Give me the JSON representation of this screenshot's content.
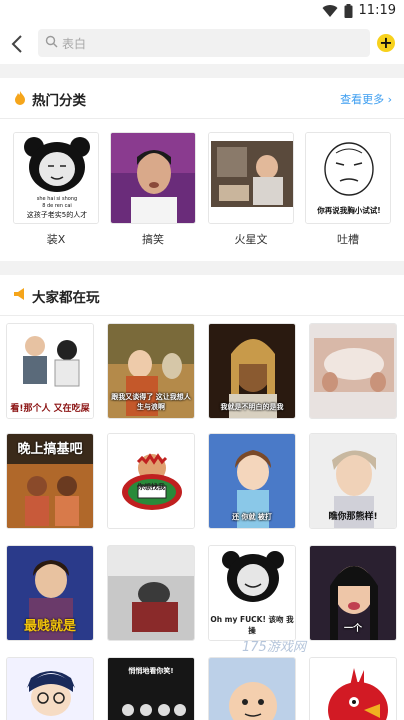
{
  "status": {
    "time": "11:19"
  },
  "header": {
    "search_placeholder": "表白",
    "add_label": "+"
  },
  "hot": {
    "title": "热门分类",
    "more": "查看更多",
    "items": [
      {
        "label": "装X",
        "caption_top": "she hai si shong",
        "caption_mid": "8 de ren cai",
        "caption_bottom": "这孩子老实5的人才"
      },
      {
        "label": "搞笑"
      },
      {
        "label": "火星文"
      },
      {
        "label": "吐槽",
        "caption_bottom": "你再说我胸小试试!"
      }
    ]
  },
  "play": {
    "title": "大家都在玩",
    "cells": [
      {
        "caption": "看!那个人 又在吃屎"
      },
      {
        "caption": "跟我又谈得了 这让我想人生与浪啊"
      },
      {
        "caption": "我就是不明白的是我"
      },
      {
        "caption": ""
      },
      {
        "caption": "晚上搞基吧"
      },
      {
        "caption": "你想找我"
      },
      {
        "caption": "还 你就 被打"
      },
      {
        "caption": "瞧你那熊样!"
      },
      {
        "caption": "最贱就是"
      },
      {
        "caption": ""
      },
      {
        "caption": "Oh my FUCK! 该吻 我操"
      },
      {
        "caption": "一个"
      },
      {
        "caption": ""
      },
      {
        "caption": "悄悄地看你笑!"
      },
      {
        "caption": ""
      },
      {
        "caption": ""
      }
    ]
  },
  "watermark": "175游戏网",
  "colors": {
    "accent_yellow": "#f7d11c",
    "link_blue": "#3b9df0"
  }
}
